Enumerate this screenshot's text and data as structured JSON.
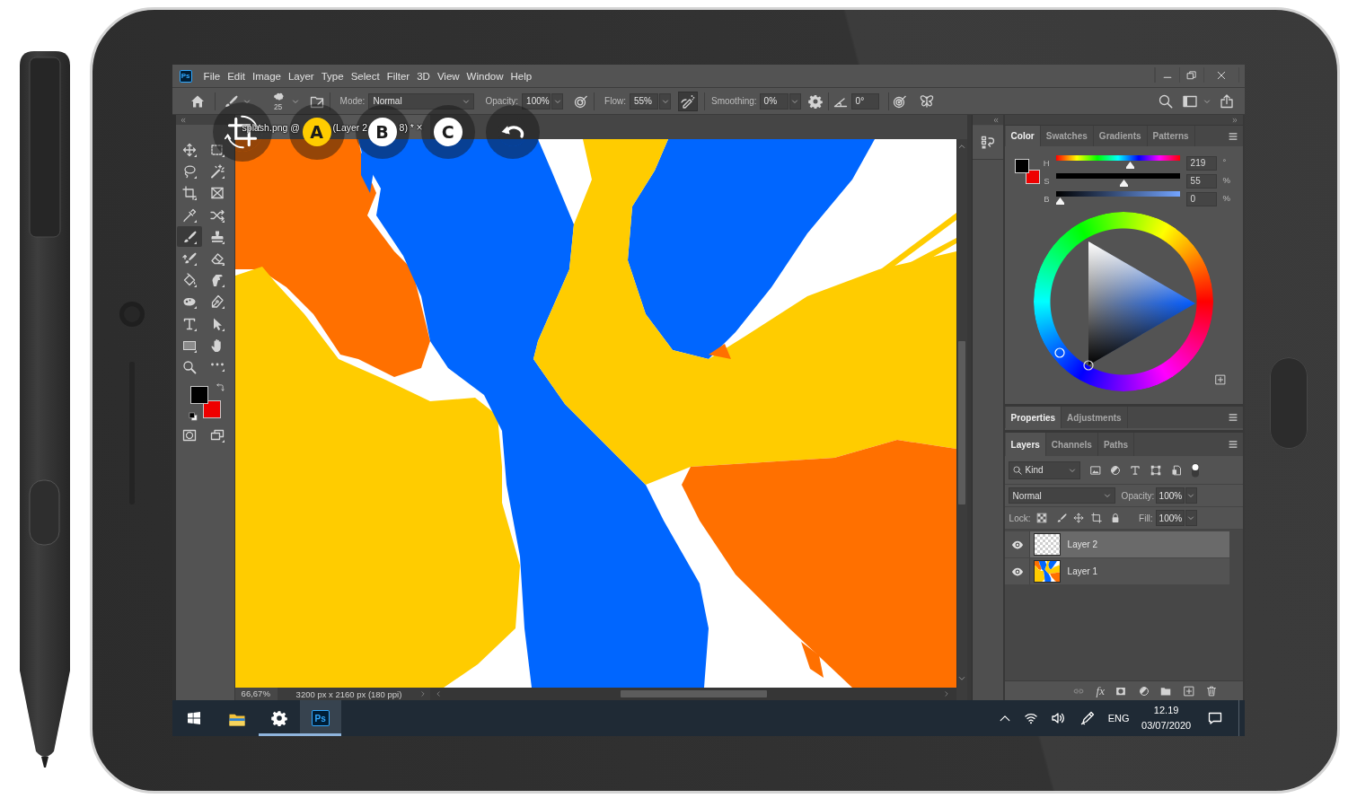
{
  "menu_bar": {
    "logo": "Ps",
    "items": [
      "File",
      "Edit",
      "Image",
      "Layer",
      "Type",
      "Select",
      "Filter",
      "3D",
      "View",
      "Window",
      "Help"
    ]
  },
  "options_bar": {
    "brush_size": "25",
    "mode": {
      "label": "Mode:",
      "value": "Normal"
    },
    "opacity": {
      "label": "Opacity:",
      "value": "100%"
    },
    "flow": {
      "label": "Flow:",
      "value": "55%"
    },
    "airbrush_on": true,
    "smoothing": {
      "label": "Smoothing:",
      "value": "0%"
    },
    "angle": "0°"
  },
  "document_tab": {
    "title_parts": [
      "splash.png @",
      "(Layer 2",
      "8) *"
    ],
    "close": "×"
  },
  "overlay_buttons": [
    {
      "kind": "crop"
    },
    {
      "kind": "letter",
      "label": "A",
      "color": "#ffcc00"
    },
    {
      "kind": "letter",
      "label": "B",
      "color": "#ffffff"
    },
    {
      "kind": "letter",
      "label": "C",
      "color": "#ffffff"
    },
    {
      "kind": "undo"
    }
  ],
  "toolbar": {
    "tools": [
      {
        "kind": "move",
        "selected": false
      },
      {
        "kind": "marquee",
        "selected": false
      },
      {
        "kind": "lasso",
        "selected": false
      },
      {
        "kind": "wand",
        "selected": false
      },
      {
        "kind": "crop",
        "selected": false
      },
      {
        "kind": "frame",
        "selected": false
      },
      {
        "kind": "eyedropper",
        "selected": false
      },
      {
        "kind": "patch",
        "selected": false
      },
      {
        "kind": "brush",
        "selected": true
      },
      {
        "kind": "stamp",
        "selected": false
      },
      {
        "kind": "historybrush",
        "selected": false
      },
      {
        "kind": "eraser",
        "selected": false
      },
      {
        "kind": "bucket",
        "selected": false
      },
      {
        "kind": "smudge",
        "selected": false
      },
      {
        "kind": "sponge",
        "selected": false
      },
      {
        "kind": "pen",
        "selected": false
      },
      {
        "kind": "type",
        "selected": false
      },
      {
        "kind": "pathselect",
        "selected": false
      },
      {
        "kind": "rectangle",
        "selected": false
      },
      {
        "kind": "hand",
        "selected": false
      },
      {
        "kind": "zoom",
        "selected": false
      },
      {
        "kind": "more",
        "selected": false
      }
    ],
    "swatches": [
      {
        "kind": "foreground",
        "color": "#000000"
      },
      {
        "kind": "background",
        "color": "#ee0000"
      }
    ]
  },
  "status_bar": {
    "zoom": "66,67%",
    "document_info": "3200 px x 2160 px (180 ppi)"
  },
  "color_panel": {
    "tabs": [
      {
        "label": "Color",
        "selected": true
      },
      {
        "label": "Swatches",
        "selected": false
      },
      {
        "label": "Gradients",
        "selected": false
      },
      {
        "label": "Patterns",
        "selected": false
      }
    ],
    "swatches": [
      {
        "kind": "foreground",
        "color": "#000000"
      },
      {
        "kind": "background",
        "color": "#ee0000"
      }
    ],
    "sliders": [
      {
        "kind": "hue",
        "label": "H",
        "level": 0.608,
        "value": "219",
        "unit": "°"
      },
      {
        "kind": "saturation",
        "label": "S",
        "level": 0.55,
        "value": "55",
        "unit": "%"
      },
      {
        "kind": "brightness",
        "label": "B",
        "level": 0,
        "value": "0",
        "unit": "%"
      }
    ]
  },
  "properties_panel": {
    "tabs": [
      {
        "label": "Properties",
        "selected": true
      },
      {
        "label": "Adjustments",
        "selected": false
      }
    ]
  },
  "layers_panel": {
    "tabs": [
      {
        "label": "Layers",
        "selected": true
      },
      {
        "label": "Channels",
        "selected": false
      },
      {
        "label": "Paths",
        "selected": false
      }
    ],
    "filter": "Kind",
    "filter_on": true,
    "blend_mode": "Normal",
    "opacity_label": "Opacity:",
    "opacity": "100%",
    "lock_label": "Lock:",
    "fill_label": "Fill:",
    "fill": "100%",
    "layers": [
      {
        "name": "Layer 2",
        "kind": "transparent",
        "visible": true,
        "selected": true
      },
      {
        "name": "Layer 1",
        "kind": "image",
        "visible": true,
        "selected": false
      }
    ],
    "link_disabled": true,
    "effects": "fx"
  },
  "taskbar": {
    "apps": [
      {
        "kind": "explorer",
        "running": false,
        "selected": false
      },
      {
        "kind": "settings",
        "running": true,
        "selected": false
      },
      {
        "kind": "photoshop",
        "badge": "Ps",
        "running": true,
        "selected": true
      }
    ],
    "language": "ENG",
    "time": "12.19",
    "date": "03/07/2020"
  }
}
